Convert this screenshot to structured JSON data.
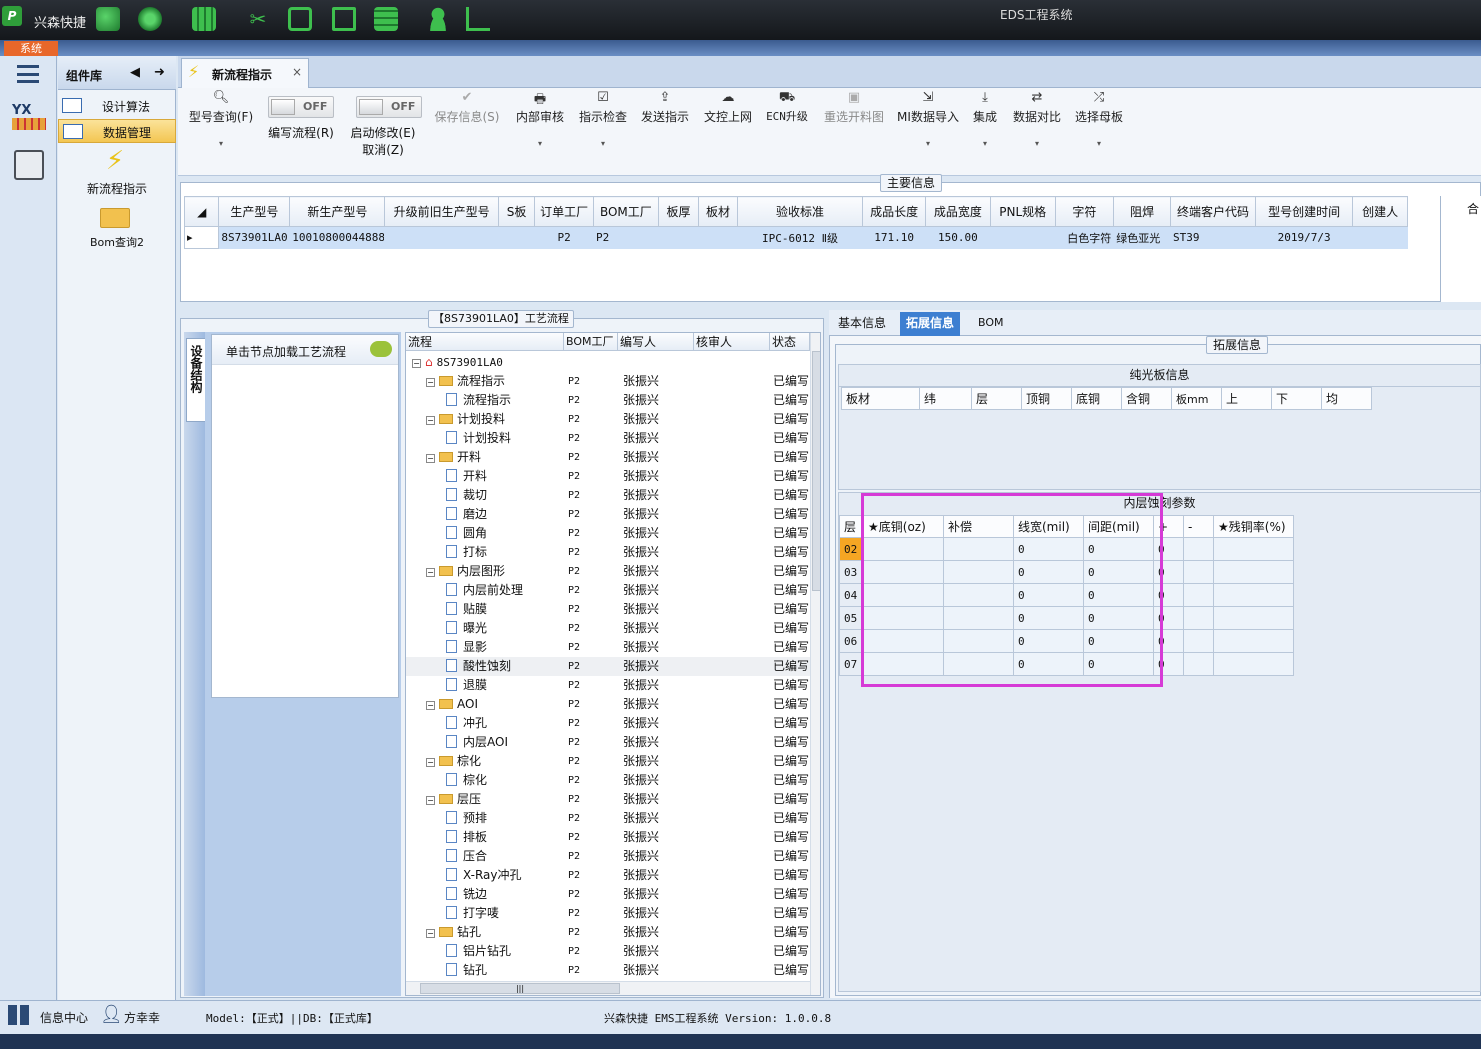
{
  "app": {
    "name": "兴森快捷",
    "window_title": "EDS工程系统",
    "menu_system": "系统"
  },
  "components": {
    "title": "组件库",
    "items": [
      {
        "label": "设计算法"
      },
      {
        "label": "数据管理"
      }
    ],
    "tiles": [
      {
        "label": "新流程指示"
      },
      {
        "label": "Bom查询2"
      }
    ]
  },
  "tab": {
    "label": "新流程指示",
    "close": "×"
  },
  "ribbon": {
    "model_query": "型号查询(F)",
    "edit_flow": "编写流程(R)",
    "start_modify": "启动修改(E)",
    "cancel": "取消(Z)",
    "toggle_off": "OFF",
    "save_info": "保存信息(S)",
    "internal_review": "内部审核",
    "instruction_check": "指示检查",
    "send_instruction": "发送指示",
    "doc_upload": "文控上网",
    "ecn_upgrade": "ECN升级",
    "reselect_image": "重选开料图",
    "mi_import": "MI数据导入",
    "integrate": "集成",
    "data_compare": "数据对比",
    "select_template": "选择母板",
    "dropdown_glyph": "▾"
  },
  "main_info": {
    "caption": "主要信息",
    "headers": [
      "生产型号",
      "新生产型号",
      "升级前旧生产型号",
      "S板",
      "订单工厂",
      "BOM工厂",
      "板厚",
      "板材",
      "验收标准",
      "成品长度",
      "成品宽度",
      "PNL规格",
      "字符",
      "阻焊",
      "终端客户代码",
      "型号创建时间",
      "创建人"
    ],
    "row": [
      "8S73901LA0",
      "10010800044888",
      "",
      "",
      "P2",
      "P2",
      "",
      "",
      "IPC-6012 Ⅱ级",
      "171.10",
      "150.00",
      "",
      "白色字符",
      "绿色亚光",
      "ST39",
      "2019/7/3",
      ""
    ],
    "side_label": "合"
  },
  "process": {
    "caption": "【8S73901LA0】工艺流程",
    "side_tab": "设备结构",
    "note": "单击节点加载工艺流程",
    "columns": [
      "流程",
      "BOM工厂",
      "编写人",
      "核审人",
      "状态"
    ],
    "root": "8S73901LA0",
    "rows": [
      {
        "name": "流程指示",
        "type": "folder",
        "bom": "P2",
        "writer": "张振兴",
        "status": "已编写"
      },
      {
        "name": "流程指示",
        "type": "doc",
        "bom": "P2",
        "writer": "张振兴",
        "status": "已编写"
      },
      {
        "name": "计划投料",
        "type": "folder",
        "bom": "P2",
        "writer": "张振兴",
        "status": "已编写"
      },
      {
        "name": "计划投料",
        "type": "doc",
        "bom": "P2",
        "writer": "张振兴",
        "status": "已编写"
      },
      {
        "name": "开料",
        "type": "folder",
        "bom": "P2",
        "writer": "张振兴",
        "status": "已编写"
      },
      {
        "name": "开料",
        "type": "doc",
        "bom": "P2",
        "writer": "张振兴",
        "status": "已编写"
      },
      {
        "name": "裁切",
        "type": "doc",
        "bom": "P2",
        "writer": "张振兴",
        "status": "已编写"
      },
      {
        "name": "磨边",
        "type": "doc",
        "bom": "P2",
        "writer": "张振兴",
        "status": "已编写"
      },
      {
        "name": "圆角",
        "type": "doc",
        "bom": "P2",
        "writer": "张振兴",
        "status": "已编写"
      },
      {
        "name": "打标",
        "type": "doc",
        "bom": "P2",
        "writer": "张振兴",
        "status": "已编写"
      },
      {
        "name": "内层图形",
        "type": "folder",
        "bom": "P2",
        "writer": "张振兴",
        "status": "已编写"
      },
      {
        "name": "内层前处理",
        "type": "doc",
        "bom": "P2",
        "writer": "张振兴",
        "status": "已编写"
      },
      {
        "name": "贴膜",
        "type": "doc",
        "bom": "P2",
        "writer": "张振兴",
        "status": "已编写"
      },
      {
        "name": "曝光",
        "type": "doc",
        "bom": "P2",
        "writer": "张振兴",
        "status": "已编写"
      },
      {
        "name": "显影",
        "type": "doc",
        "bom": "P2",
        "writer": "张振兴",
        "status": "已编写"
      },
      {
        "name": "酸性蚀刻",
        "type": "doc",
        "bom": "P2",
        "writer": "张振兴",
        "status": "已编写"
      },
      {
        "name": "退膜",
        "type": "doc",
        "bom": "P2",
        "writer": "张振兴",
        "status": "已编写"
      },
      {
        "name": "AOI",
        "type": "folder",
        "bom": "P2",
        "writer": "张振兴",
        "status": "已编写"
      },
      {
        "name": "冲孔",
        "type": "doc",
        "bom": "P2",
        "writer": "张振兴",
        "status": "已编写"
      },
      {
        "name": "内层AOI",
        "type": "doc",
        "bom": "P2",
        "writer": "张振兴",
        "status": "已编写"
      },
      {
        "name": "棕化",
        "type": "folder",
        "bom": "P2",
        "writer": "张振兴",
        "status": "已编写"
      },
      {
        "name": "棕化",
        "type": "doc",
        "bom": "P2",
        "writer": "张振兴",
        "status": "已编写"
      },
      {
        "name": "层压",
        "type": "folder",
        "bom": "P2",
        "writer": "张振兴",
        "status": "已编写"
      },
      {
        "name": "预排",
        "type": "doc",
        "bom": "P2",
        "writer": "张振兴",
        "status": "已编写"
      },
      {
        "name": "排板",
        "type": "doc",
        "bom": "P2",
        "writer": "张振兴",
        "status": "已编写"
      },
      {
        "name": "压合",
        "type": "doc",
        "bom": "P2",
        "writer": "张振兴",
        "status": "已编写"
      },
      {
        "name": "X-Ray冲孔",
        "type": "doc",
        "bom": "P2",
        "writer": "张振兴",
        "status": "已编写"
      },
      {
        "name": "铣边",
        "type": "doc",
        "bom": "P2",
        "writer": "张振兴",
        "status": "已编写"
      },
      {
        "name": "打字唛",
        "type": "doc",
        "bom": "P2",
        "writer": "张振兴",
        "status": "已编写"
      },
      {
        "name": "钻孔",
        "type": "folder",
        "bom": "P2",
        "writer": "张振兴",
        "status": "已编写"
      },
      {
        "name": "铝片钻孔",
        "type": "doc",
        "bom": "P2",
        "writer": "张振兴",
        "status": "已编写"
      },
      {
        "name": "钻孔",
        "type": "doc",
        "bom": "P2",
        "writer": "张振兴",
        "status": "已编写"
      }
    ],
    "scroll_thumb": "|||"
  },
  "detail": {
    "tabs": [
      "基本信息",
      "拓展信息",
      "BOM"
    ],
    "active_tab": "拓展信息",
    "caption": "拓展信息",
    "light_board": {
      "title": "纯光板信息",
      "headers": [
        "板材",
        "纬",
        "层",
        "顶铜",
        "底铜",
        "含铜",
        "板mm",
        "上",
        "下",
        "均"
      ]
    },
    "inner_etch": {
      "title": "内层蚀刻参数",
      "headers": [
        "层",
        "★底铜(oz)",
        "补偿",
        "线宽(mil)",
        "间距(mil)",
        "+",
        "-",
        "★残铜率(%)"
      ],
      "rows": [
        [
          "02",
          "",
          "",
          "0",
          "0",
          "0",
          "",
          ""
        ],
        [
          "03",
          "",
          "",
          "0",
          "0",
          "0",
          "",
          ""
        ],
        [
          "04",
          "",
          "",
          "0",
          "0",
          "0",
          "",
          ""
        ],
        [
          "05",
          "",
          "",
          "0",
          "0",
          "0",
          "",
          ""
        ],
        [
          "06",
          "",
          "",
          "0",
          "0",
          "0",
          "",
          ""
        ],
        [
          "07",
          "",
          "",
          "0",
          "0",
          "0",
          "",
          ""
        ]
      ],
      "highlight_color": "#d63ad6",
      "selected_row_color": "#f5a623"
    }
  },
  "status": {
    "info_center": "信息中心",
    "user": "方幸幸",
    "model_db": "Model:【正式】||DB:【正式库】",
    "version": "兴森快捷 EMS工程系统 Version: 1.0.0.8"
  },
  "colors": {
    "accent": "#3d7fd1",
    "selection": "#cde0f7"
  }
}
